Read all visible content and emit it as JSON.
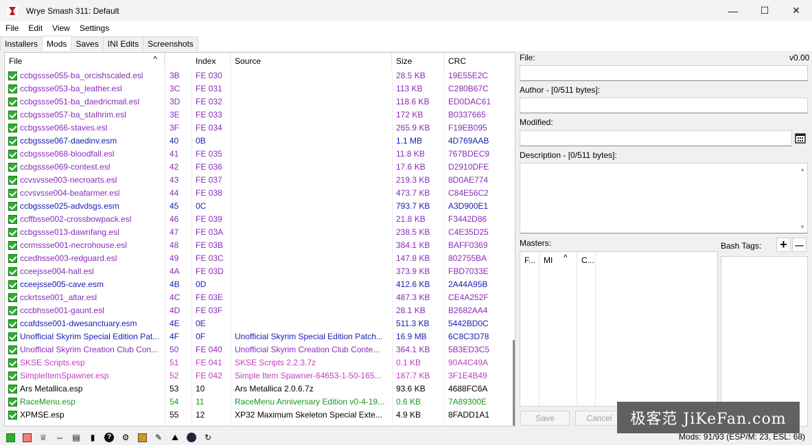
{
  "window": {
    "title": "Wrye Smash 311: Default",
    "minimize": "—",
    "maximize": "☐",
    "close": "✕"
  },
  "menu": [
    "File",
    "Edit",
    "View",
    "Settings"
  ],
  "tabs": [
    "Installers",
    "Mods",
    "Saves",
    "INI Edits",
    "Screenshots"
  ],
  "active_tab": "Mods",
  "columns": {
    "file": "File",
    "index": "Index",
    "source": "Source",
    "size": "Size",
    "crc": "CRC",
    "sort_arrow": "^"
  },
  "colors": {
    "purple": "#8a2bb8",
    "blue": "#1a1ab4",
    "pink": "#c040c0",
    "green": "#1a9a1a",
    "black": "#000000"
  },
  "mods": [
    {
      "file": "ccbgssse055-ba_orcishscaled.esl",
      "load": "3B",
      "index": "FE 030",
      "source": "",
      "size": "28.5 KB",
      "crc": "19E55E2C",
      "color": "purple"
    },
    {
      "file": "ccbgssse053-ba_leather.esl",
      "load": "3C",
      "index": "FE 031",
      "source": "",
      "size": "113 KB",
      "crc": "C280B67C",
      "color": "purple"
    },
    {
      "file": "ccbgssse051-ba_daedricmail.esl",
      "load": "3D",
      "index": "FE 032",
      "source": "",
      "size": "118.6 KB",
      "crc": "ED0DAC61",
      "color": "purple"
    },
    {
      "file": "ccbgssse057-ba_stalhrim.esl",
      "load": "3E",
      "index": "FE 033",
      "source": "",
      "size": "172 KB",
      "crc": "B0337665",
      "color": "purple"
    },
    {
      "file": "ccbgssse066-staves.esl",
      "load": "3F",
      "index": "FE 034",
      "source": "",
      "size": "265.9 KB",
      "crc": "F19EB095",
      "color": "purple"
    },
    {
      "file": "ccbgssse067-daedinv.esm",
      "load": "40",
      "index": "0B",
      "source": "",
      "size": "1.1 MB",
      "crc": "4D769AAB",
      "color": "blue"
    },
    {
      "file": "ccbgssse068-bloodfall.esl",
      "load": "41",
      "index": "FE 035",
      "source": "",
      "size": "11.8 KB",
      "crc": "767BDEC9",
      "color": "purple"
    },
    {
      "file": "ccbgssse069-contest.esl",
      "load": "42",
      "index": "FE 036",
      "source": "",
      "size": "17.6 KB",
      "crc": "D2910DFE",
      "color": "purple"
    },
    {
      "file": "ccvsvsse003-necroarts.esl",
      "load": "43",
      "index": "FE 037",
      "source": "",
      "size": "219.3 KB",
      "crc": "8D0AE774",
      "color": "purple"
    },
    {
      "file": "ccvsvsse004-beafarmer.esl",
      "load": "44",
      "index": "FE 038",
      "source": "",
      "size": "473.7 KB",
      "crc": "C84E56C2",
      "color": "purple"
    },
    {
      "file": "ccbgssse025-advdsgs.esm",
      "load": "45",
      "index": "0C",
      "source": "",
      "size": "793.7 KB",
      "crc": "A3D900E1",
      "color": "blue"
    },
    {
      "file": "ccffbsse002-crossbowpack.esl",
      "load": "46",
      "index": "FE 039",
      "source": "",
      "size": "21.8 KB",
      "crc": "F3442D86",
      "color": "purple"
    },
    {
      "file": "ccbgssse013-dawnfang.esl",
      "load": "47",
      "index": "FE 03A",
      "source": "",
      "size": "238.5 KB",
      "crc": "C4E35D25",
      "color": "purple"
    },
    {
      "file": "ccrmssse001-necrohouse.esl",
      "load": "48",
      "index": "FE 03B",
      "source": "",
      "size": "384.1 KB",
      "crc": "BAFF0369",
      "color": "purple"
    },
    {
      "file": "ccedhsse003-redguard.esl",
      "load": "49",
      "index": "FE 03C",
      "source": "",
      "size": "147.8 KB",
      "crc": "802755BA",
      "color": "purple"
    },
    {
      "file": "cceejsse004-hall.esl",
      "load": "4A",
      "index": "FE 03D",
      "source": "",
      "size": "373.9 KB",
      "crc": "FBD7033E",
      "color": "purple"
    },
    {
      "file": "cceejsse005-cave.esm",
      "load": "4B",
      "index": "0D",
      "source": "",
      "size": "412.6 KB",
      "crc": "2A44A95B",
      "color": "blue"
    },
    {
      "file": "cckrtsse001_altar.esl",
      "load": "4C",
      "index": "FE 03E",
      "source": "",
      "size": "487.3 KB",
      "crc": "CE4A252F",
      "color": "purple"
    },
    {
      "file": "cccbhsse001-gaunt.esl",
      "load": "4D",
      "index": "FE 03F",
      "source": "",
      "size": "28.1 KB",
      "crc": "B2682AA4",
      "color": "purple"
    },
    {
      "file": "ccafdsse001-dwesanctuary.esm",
      "load": "4E",
      "index": "0E",
      "source": "",
      "size": "511.3 KB",
      "crc": "5442BD0C",
      "color": "blue"
    },
    {
      "file": "Unofficial Skyrim Special Edition Pat...",
      "load": "4F",
      "index": "0F",
      "source": "Unofficial Skyrim Special Edition Patch...",
      "size": "16.9 MB",
      "crc": "6C8C3D78",
      "color": "blue"
    },
    {
      "file": "Unofficial Skyrim Creation Club Con...",
      "load": "50",
      "index": "FE 040",
      "source": "Unofficial Skyrim Creation Club Conte...",
      "size": "364.1 KB",
      "crc": "5B3ED3C5",
      "color": "purple"
    },
    {
      "file": "SKSE Scripts.esp",
      "load": "51",
      "index": "FE 041",
      "source": "SKSE Scripts 2.2.3.7z",
      "size": "0.1 KB",
      "crc": "90A4C49A",
      "color": "pink"
    },
    {
      "file": "SimpleItemSpawner.esp",
      "load": "52",
      "index": "FE 042",
      "source": "Simple Item Spawner-64653-1-50-165...",
      "size": "187.7 KB",
      "crc": "3F1E4B49",
      "color": "pink"
    },
    {
      "file": "Ars Metallica.esp",
      "load": "53",
      "index": "10",
      "source": "Ars Metallica 2.0.6.7z",
      "size": "93.6 KB",
      "crc": "4688FC6A",
      "color": "black"
    },
    {
      "file": "RaceMenu.esp",
      "load": "54",
      "index": "11",
      "source": "RaceMenu Anniversary Edition v0-4-19...",
      "size": "0.6 KB",
      "crc": "7A89300E",
      "color": "green"
    },
    {
      "file": "XPMSE.esp",
      "load": "55",
      "index": "12",
      "source": "XP32 Maximum Skeleton Special Exte...",
      "size": "4.9 KB",
      "crc": "8FADD1A1",
      "color": "black"
    }
  ],
  "right_panel": {
    "file_label": "File:",
    "version": "v0.00",
    "author_label": "Author - [0/511 bytes]:",
    "modified_label": "Modified:",
    "description_label": "Description - [0/511 bytes]:",
    "masters_label": "Masters:",
    "masters_cols": [
      "F...",
      "MI",
      "C..."
    ],
    "bash_tags_label": "Bash Tags:",
    "add_tag": "+",
    "remove_tag": "—",
    "save_label": "Save",
    "cancel_label": "Cancel"
  },
  "status": {
    "mods": "Mods: 91/93 (ESP/M: 23, ESL: 68)"
  },
  "watermark": "极客范 JiKeFan.com"
}
